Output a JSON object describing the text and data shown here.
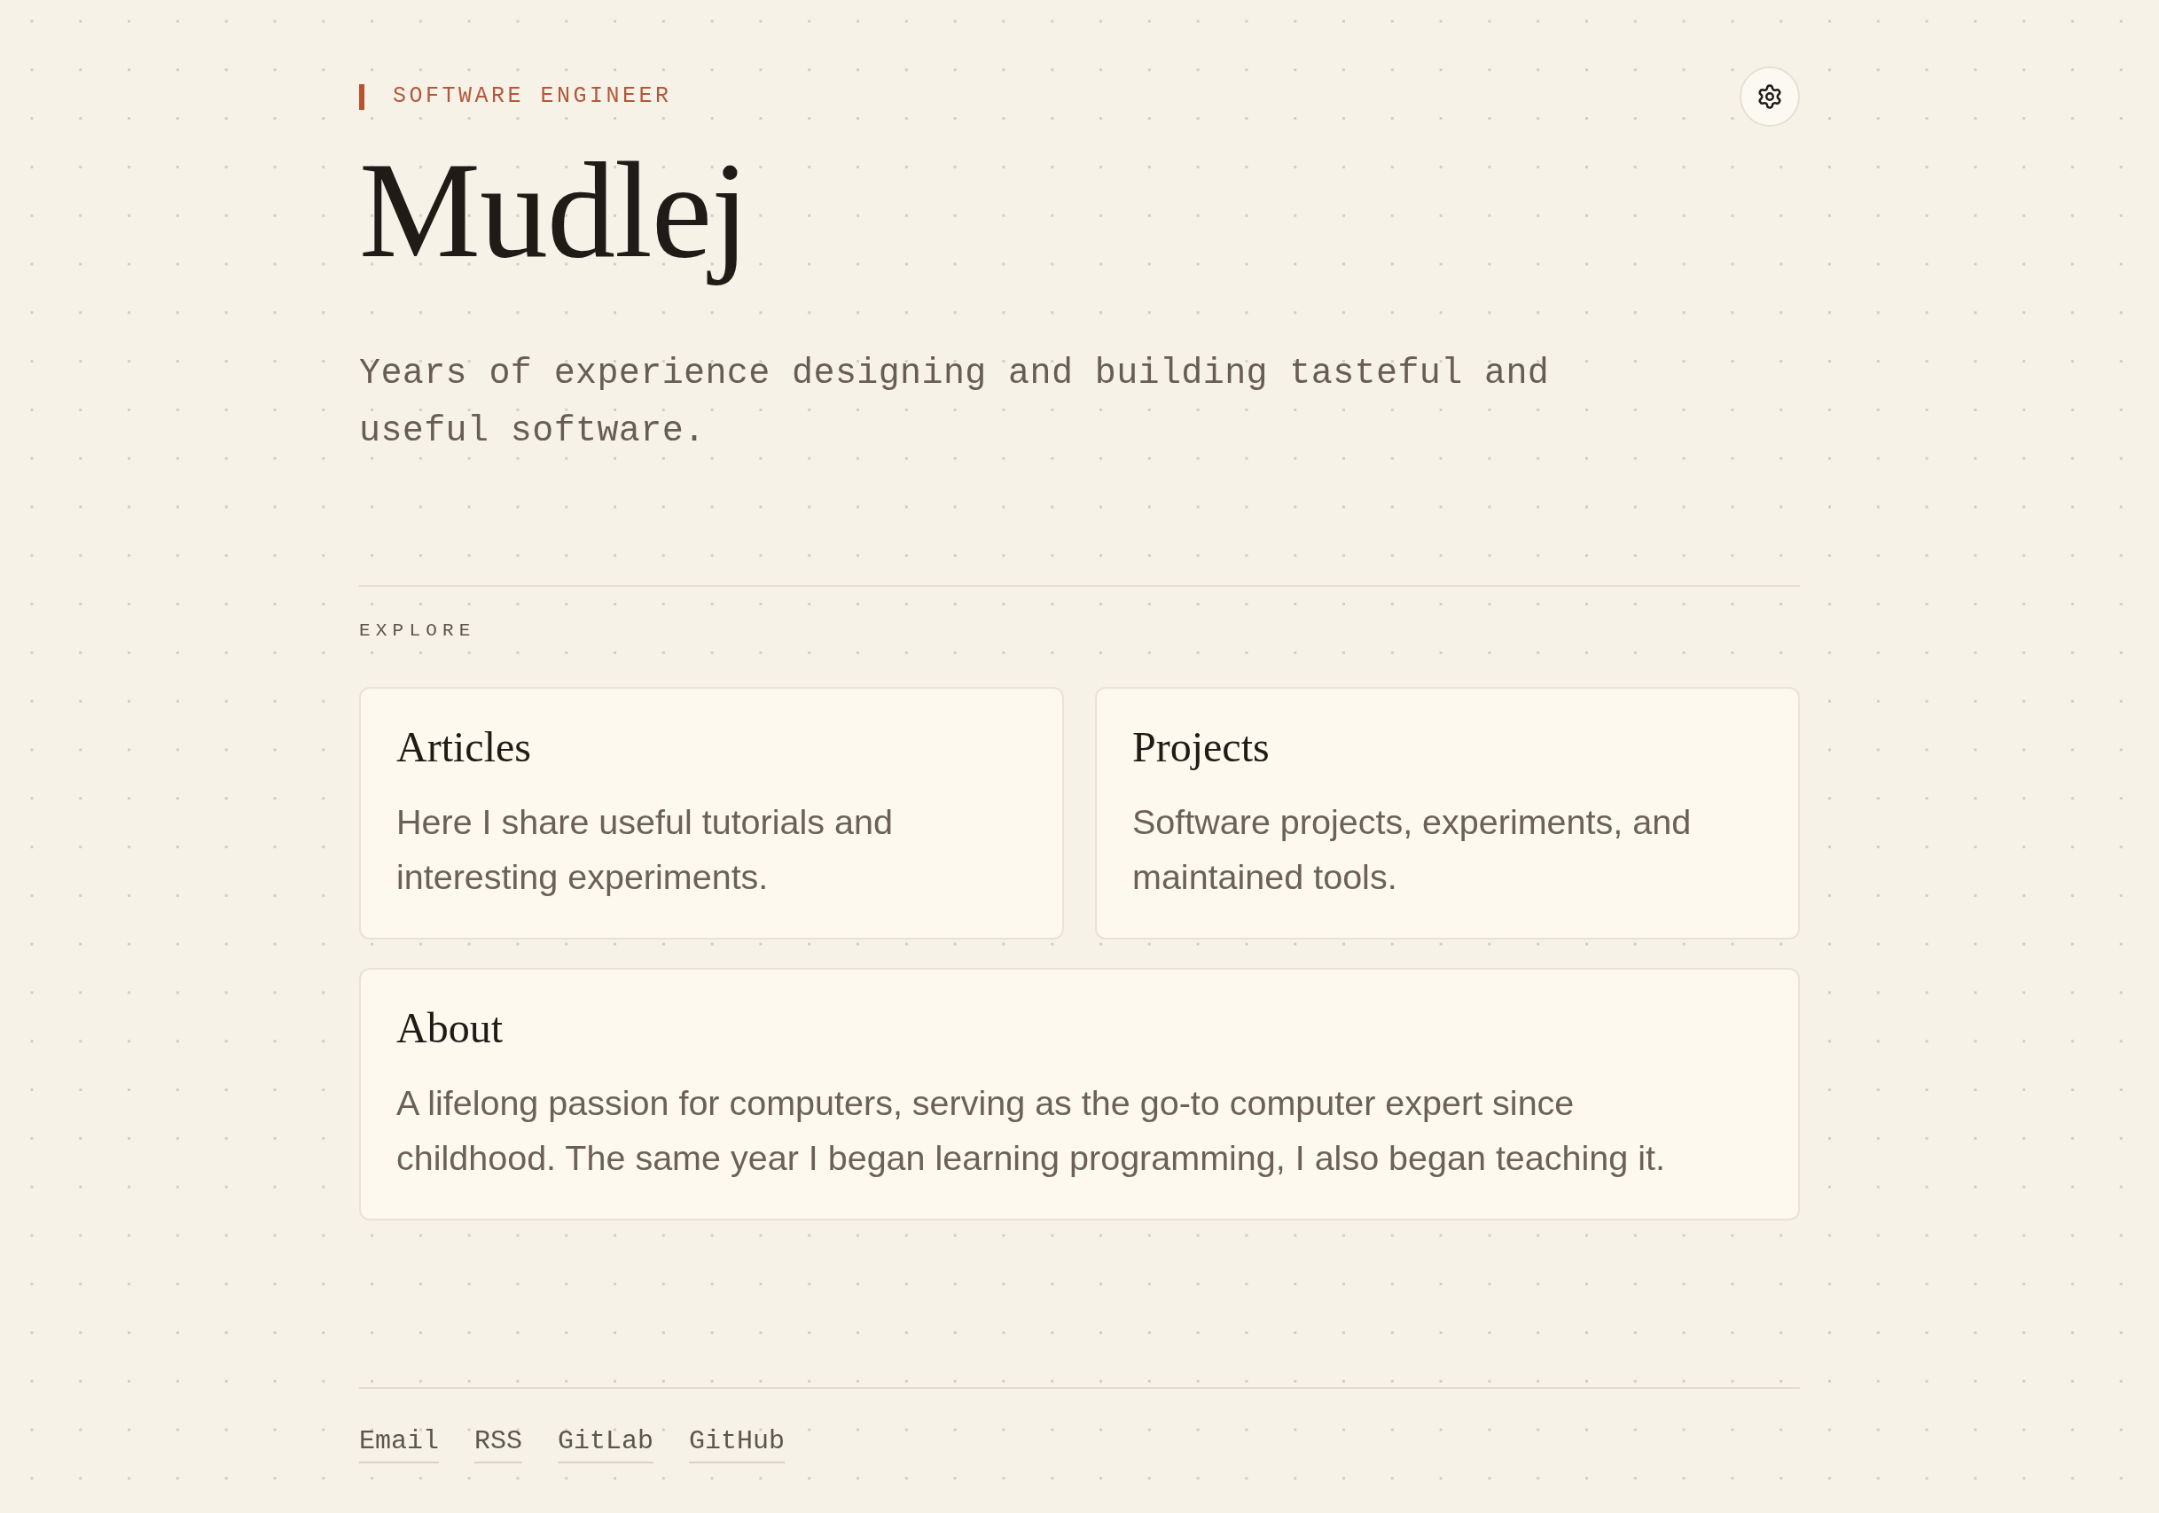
{
  "header": {
    "tag": "SOFTWARE ENGINEER",
    "title": "Mudlej",
    "tagline": "Years of experience designing and building tasteful and useful software."
  },
  "explore": {
    "heading": "EXPLORE",
    "cards": [
      {
        "title": "Articles",
        "description": "Here I share useful tutorials and interesting experiments."
      },
      {
        "title": "Projects",
        "description": "Software projects, experiments, and maintained tools."
      },
      {
        "title": "About",
        "description": "A lifelong passion for computers, serving as the go-to computer expert since childhood. The same year I began learning programming, I also began teaching it."
      }
    ]
  },
  "footer": {
    "links": [
      "Email",
      "RSS",
      "GitLab",
      "GitHub"
    ]
  }
}
